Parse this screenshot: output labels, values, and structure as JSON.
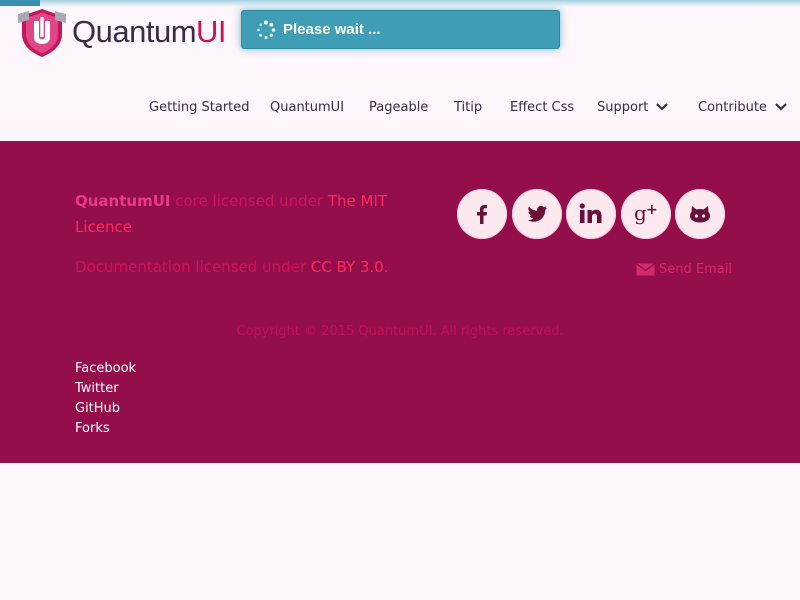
{
  "logo": {
    "text_main": "Quantum",
    "text_accent": "UI",
    "shield_letter": "U"
  },
  "loading": {
    "text": "Please wait ..."
  },
  "nav": {
    "items": [
      {
        "label": "Getting Started"
      },
      {
        "label": "QuantumUI"
      },
      {
        "label": "Pageable"
      },
      {
        "label": "Titip"
      },
      {
        "label": "Effect Css"
      },
      {
        "label": "Support",
        "icon": "chevron-down-icon"
      },
      {
        "label": "Contribute",
        "icon": "chevron-down-icon"
      }
    ]
  },
  "footer": {
    "license": {
      "brand": "QuantumUI",
      "core_text": " core licensed under ",
      "mit_link": "The MIT Licence",
      "docs_text": "Documentation licensed under ",
      "cc_link": "CC BY 3.0."
    },
    "social": [
      {
        "icon": "facebook-icon"
      },
      {
        "icon": "twitter-icon"
      },
      {
        "icon": "linkedin-icon"
      },
      {
        "icon": "google-plus-icon"
      },
      {
        "icon": "github-icon"
      }
    ],
    "send_email": "Send Email",
    "copyright": "Copyright © 2015 QuantumUI. All rights reserved.",
    "links": [
      "Facebook",
      "Twitter",
      "GitHub",
      "Forks"
    ]
  },
  "colors": {
    "footer_bg": "#950e4c",
    "brand_pink": "#c2185b",
    "loading_bg": "#3f9db5",
    "page_bg": "#fdf6fa"
  }
}
